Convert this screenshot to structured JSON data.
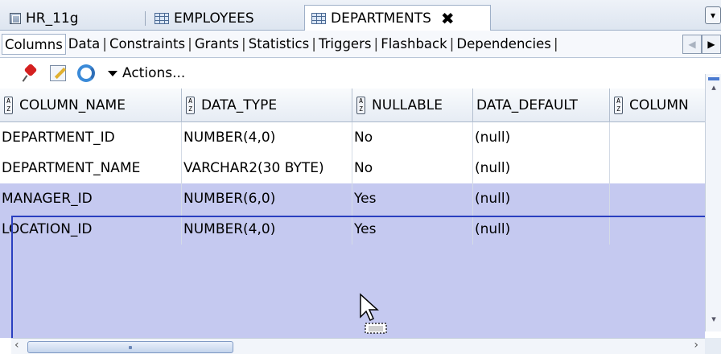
{
  "tabs": [
    {
      "label": "HR_11g",
      "icon": "database-icon",
      "active": false
    },
    {
      "label": "EMPLOYEES",
      "icon": "table-icon",
      "active": false
    },
    {
      "label": "DEPARTMENTS",
      "icon": "table-icon",
      "active": true,
      "closable": true
    }
  ],
  "close_glyph": "✖",
  "tab_list_glyph": "▾",
  "subtabs": [
    "Columns",
    "Data",
    "Constraints",
    "Grants",
    "Statistics",
    "Triggers",
    "Flashback",
    "Dependencies"
  ],
  "subtab_separator": "|",
  "subtab_active": "Columns",
  "subtab_scroll": {
    "left": "◀",
    "right": "▶"
  },
  "toolbar": {
    "actions_label": "Actions...",
    "icons": [
      "pin-icon",
      "edit-icon",
      "refresh-icon"
    ]
  },
  "grid": {
    "columns": [
      {
        "label": "COLUMN_NAME",
        "sortable_icon": true
      },
      {
        "label": "DATA_TYPE",
        "sortable_icon": true
      },
      {
        "label": "NULLABLE",
        "sortable_icon": true
      },
      {
        "label": "DATA_DEFAULT",
        "sortable_icon": false
      },
      {
        "label": "COLUMN",
        "sortable_icon": true
      }
    ],
    "sort_glyph": "A\nZ",
    "rows": [
      {
        "column_name": "DEPARTMENT_ID",
        "data_type": "NUMBER(4,0)",
        "nullable": "No",
        "data_default": "(null)",
        "selected": false
      },
      {
        "column_name": "DEPARTMENT_NAME",
        "data_type": "VARCHAR2(30 BYTE)",
        "nullable": "No",
        "data_default": "(null)",
        "selected": false
      },
      {
        "column_name": "MANAGER_ID",
        "data_type": "NUMBER(6,0)",
        "nullable": "Yes",
        "data_default": "(null)",
        "selected": true
      },
      {
        "column_name": "LOCATION_ID",
        "data_type": "NUMBER(4,0)",
        "nullable": "Yes",
        "data_default": "(null)",
        "selected": true
      }
    ]
  },
  "scroll": {
    "up": "▴",
    "down": "▾",
    "left": "‹",
    "right": "›"
  },
  "colors": {
    "selection": "#c5c9f0",
    "selection_border": "#2a3fc0",
    "tab_border": "#9fb0c8"
  }
}
